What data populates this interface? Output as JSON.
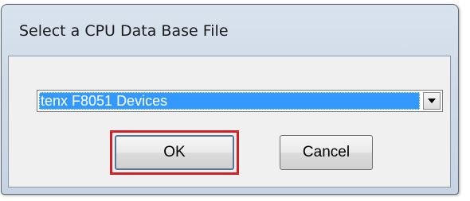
{
  "dialog": {
    "title": "Select a CPU Data Base File"
  },
  "combo": {
    "selected_value": "tenx F8051 Devices",
    "dropdown_icon": "chevron-down-icon"
  },
  "buttons": {
    "ok_label": "OK",
    "cancel_label": "Cancel"
  },
  "annotation": {
    "highlight_color": "#d21f26",
    "highlight_target": "ok-button"
  },
  "colors": {
    "selection": "#3399ff"
  }
}
